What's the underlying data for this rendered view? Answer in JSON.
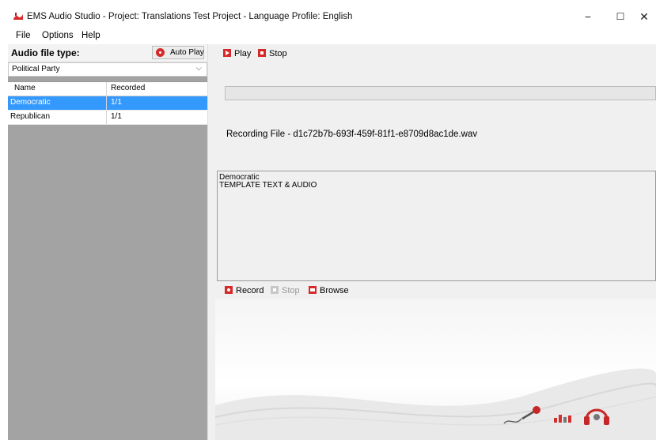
{
  "window": {
    "title": "EMS Audio Studio - Project: Translations Test Project - Language Profile: English",
    "controls": {
      "minimize": "−",
      "maximize": "☐",
      "close": "✕"
    }
  },
  "menu": {
    "items": [
      "File",
      "Options",
      "Help"
    ]
  },
  "left": {
    "header_label": "Audio file type:",
    "auto_play_label": "Auto Play",
    "select_value": "Political Party",
    "table": {
      "columns": [
        "Name",
        "Recorded"
      ],
      "rows": [
        {
          "name": "Democratic",
          "recorded": "1/1",
          "selected": true
        },
        {
          "name": "Republican",
          "recorded": "1/1",
          "selected": false
        }
      ]
    }
  },
  "right": {
    "toolbar": {
      "play_label": "Play",
      "stop_label": "Stop"
    },
    "progress": {
      "percent": 0
    },
    "recording_file": "Recording File - d1c72b7b-693f-459f-81f1-e8709d8ac1de.wav",
    "textbox_lines": [
      "Democratic",
      "TEMPLATE TEXT & AUDIO"
    ],
    "toolbar2": {
      "record_label": "Record",
      "stop_label": "Stop",
      "browse_label": "Browse"
    }
  },
  "icons": {
    "app": "ems-app-icon",
    "auto_play": "record-circle-icon",
    "play": "play-icon",
    "stop": "stop-icon",
    "record": "record-icon",
    "browse": "browse-icon",
    "dropdown": "chevron-down-icon",
    "logos": [
      "microphone-icon",
      "equalizer-bars-icon",
      "headphones-icon"
    ]
  },
  "colors": {
    "accent": "#d42a2a",
    "selection": "#3399ff",
    "pane_gray": "#a3a3a3",
    "panel_bg": "#f0f0f0"
  }
}
